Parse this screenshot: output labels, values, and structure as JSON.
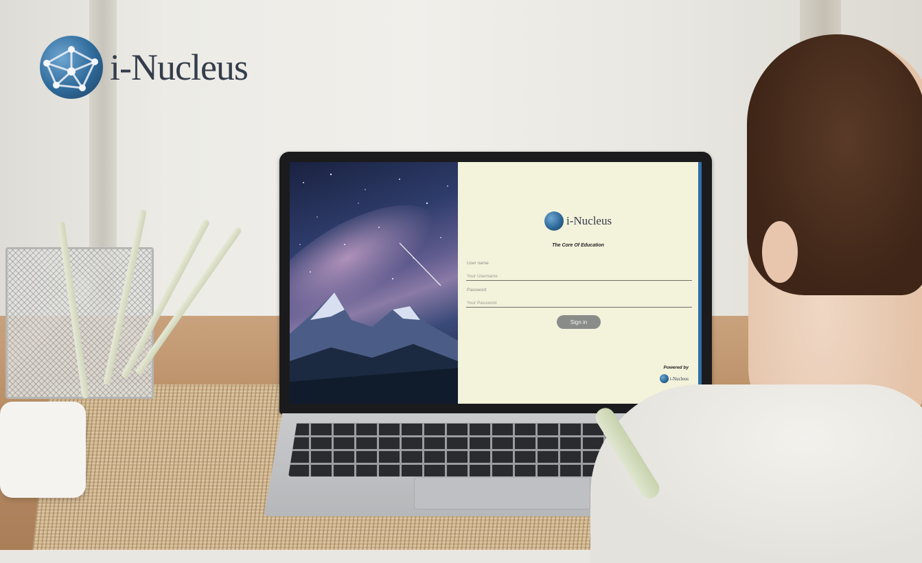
{
  "brand": {
    "name": "i-Nucleus",
    "logo_icon": "globe-network-icon",
    "accent_color": "#2e6a9a"
  },
  "login": {
    "logo_name": "i-Nucleus",
    "tagline": "The Core Of Education",
    "username_label": "User name",
    "username_placeholder": "Your Username",
    "password_label": "Password",
    "password_placeholder": "Your Password",
    "signin_label": "Sign in",
    "powered_by": "Powered by",
    "powered_name": "i-Nucleus",
    "panel_color": "#f3f2db",
    "button_color": "#8a8c8a"
  }
}
